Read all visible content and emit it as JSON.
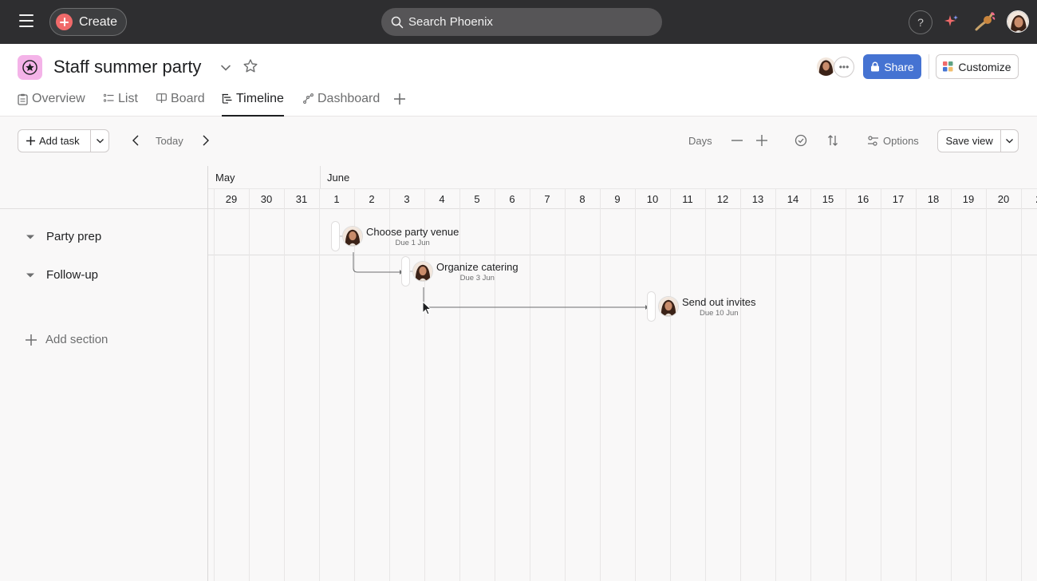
{
  "topbar": {
    "create_label": "Create",
    "search_placeholder": "Search Phoenix",
    "help_label": "?"
  },
  "project": {
    "title": "Staff summer party",
    "share_label": "Share",
    "customize_label": "Customize",
    "icon_color": "#f4b3e8"
  },
  "tabs": [
    {
      "label": "Overview"
    },
    {
      "label": "List"
    },
    {
      "label": "Board"
    },
    {
      "label": "Timeline",
      "active": true
    },
    {
      "label": "Dashboard"
    }
  ],
  "toolbar": {
    "add_task_label": "Add task",
    "today_label": "Today",
    "days_label": "Days",
    "options_label": "Options",
    "save_view_label": "Save view"
  },
  "timeline": {
    "months": [
      "May",
      "June"
    ],
    "days": [
      "29",
      "30",
      "31",
      "1",
      "2",
      "3",
      "4",
      "5",
      "6",
      "7",
      "8",
      "9",
      "10",
      "11",
      "12",
      "13",
      "14",
      "15",
      "16",
      "17",
      "18",
      "19",
      "20",
      "2"
    ]
  },
  "sections": [
    {
      "label": "Party prep"
    },
    {
      "label": "Follow-up"
    }
  ],
  "add_section_label": "Add section",
  "tasks": [
    {
      "name": "Choose party venue",
      "due": "Due 1 Jun"
    },
    {
      "name": "Organize catering",
      "due": "Due 3 Jun"
    },
    {
      "name": "Send out invites",
      "due": "Due 10 Jun"
    }
  ],
  "colors": {
    "accent": "#4573d2",
    "create": "#f06a6a",
    "topbar": "#2e2e30"
  }
}
